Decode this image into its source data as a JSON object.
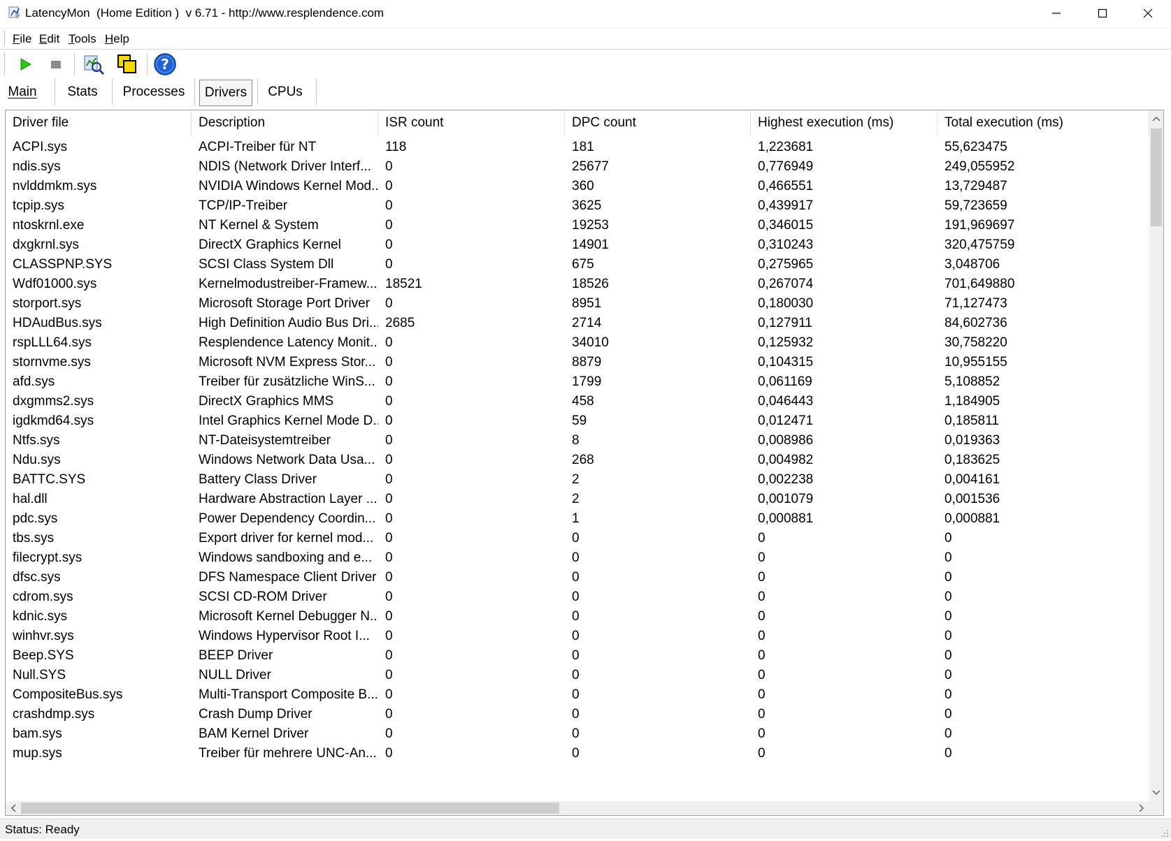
{
  "window": {
    "title": "LatencyMon  (Home Edition )  v 6.71 - http://www.resplendence.com"
  },
  "menu": [
    {
      "label": "File",
      "accel": "F",
      "rest": "ile"
    },
    {
      "label": "Edit",
      "accel": "E",
      "rest": "dit"
    },
    {
      "label": "Tools",
      "accel": "T",
      "rest": "ools"
    },
    {
      "label": "Help",
      "accel": "H",
      "rest": "elp"
    }
  ],
  "toolbar": {
    "icons": [
      "play-icon",
      "stop-icon",
      "inspect-icon",
      "copy-windows-icon",
      "help-icon"
    ],
    "colors": {
      "play": "#2ec41a",
      "stop": "#8c8c8c",
      "help": "#1d63d8"
    }
  },
  "tabs": [
    {
      "label": "Main",
      "active": false
    },
    {
      "label": "Stats",
      "active": false
    },
    {
      "label": "Processes",
      "active": false
    },
    {
      "label": "Drivers",
      "active": true
    },
    {
      "label": "CPUs",
      "active": false
    }
  ],
  "table": {
    "columns": [
      "Driver file",
      "Description",
      "ISR count",
      "DPC count",
      "Highest execution (ms)",
      "Total execution (ms)"
    ],
    "rows": [
      [
        "ACPI.sys",
        "ACPI-Treiber für NT",
        "118",
        "181",
        "1,223681",
        "55,623475"
      ],
      [
        "ndis.sys",
        "NDIS (Network Driver Interf...",
        "0",
        "25677",
        "0,776949",
        "249,055952"
      ],
      [
        "nvlddmkm.sys",
        "NVIDIA Windows Kernel Mod...",
        "0",
        "360",
        "0,466551",
        "13,729487"
      ],
      [
        "tcpip.sys",
        "TCP/IP-Treiber",
        "0",
        "3625",
        "0,439917",
        "59,723659"
      ],
      [
        "ntoskrnl.exe",
        "NT Kernel & System",
        "0",
        "19253",
        "0,346015",
        "191,969697"
      ],
      [
        "dxgkrnl.sys",
        "DirectX Graphics Kernel",
        "0",
        "14901",
        "0,310243",
        "320,475759"
      ],
      [
        "CLASSPNP.SYS",
        "SCSI Class System Dll",
        "0",
        "675",
        "0,275965",
        "3,048706"
      ],
      [
        "Wdf01000.sys",
        "Kernelmodustreiber-Framew...",
        "18521",
        "18526",
        "0,267074",
        "701,649880"
      ],
      [
        "storport.sys",
        "Microsoft Storage Port Driver",
        "0",
        "8951",
        "0,180030",
        "71,127473"
      ],
      [
        "HDAudBus.sys",
        "High Definition Audio Bus Dri...",
        "2685",
        "2714",
        "0,127911",
        "84,602736"
      ],
      [
        "rspLLL64.sys",
        "Resplendence Latency Monit...",
        "0",
        "34010",
        "0,125932",
        "30,758220"
      ],
      [
        "stornvme.sys",
        "Microsoft NVM Express Stor...",
        "0",
        "8879",
        "0,104315",
        "10,955155"
      ],
      [
        "afd.sys",
        "Treiber für zusätzliche WinS...",
        "0",
        "1799",
        "0,061169",
        "5,108852"
      ],
      [
        "dxgmms2.sys",
        "DirectX Graphics MMS",
        "0",
        "458",
        "0,046443",
        "1,184905"
      ],
      [
        "igdkmd64.sys",
        "Intel Graphics Kernel Mode D...",
        "0",
        "59",
        "0,012471",
        "0,185811"
      ],
      [
        "Ntfs.sys",
        "NT-Dateisystemtreiber",
        "0",
        "8",
        "0,008986",
        "0,019363"
      ],
      [
        "Ndu.sys",
        "Windows Network Data Usa...",
        "0",
        "268",
        "0,004982",
        "0,183625"
      ],
      [
        "BATTC.SYS",
        "Battery Class Driver",
        "0",
        "2",
        "0,002238",
        "0,004161"
      ],
      [
        "hal.dll",
        "Hardware Abstraction Layer ...",
        "0",
        "2",
        "0,001079",
        "0,001536"
      ],
      [
        "pdc.sys",
        "Power Dependency Coordin...",
        "0",
        "1",
        "0,000881",
        "0,000881"
      ],
      [
        "tbs.sys",
        "Export driver for kernel mod...",
        "0",
        "0",
        "0",
        "0"
      ],
      [
        "filecrypt.sys",
        "Windows sandboxing and e...",
        "0",
        "0",
        "0",
        "0"
      ],
      [
        "dfsc.sys",
        "DFS Namespace Client Driver",
        "0",
        "0",
        "0",
        "0"
      ],
      [
        "cdrom.sys",
        "SCSI CD-ROM Driver",
        "0",
        "0",
        "0",
        "0"
      ],
      [
        "kdnic.sys",
        "Microsoft Kernel Debugger N...",
        "0",
        "0",
        "0",
        "0"
      ],
      [
        "winhvr.sys",
        "Windows Hypervisor Root I...",
        "0",
        "0",
        "0",
        "0"
      ],
      [
        "Beep.SYS",
        "BEEP Driver",
        "0",
        "0",
        "0",
        "0"
      ],
      [
        "Null.SYS",
        "NULL Driver",
        "0",
        "0",
        "0",
        "0"
      ],
      [
        "CompositeBus.sys",
        "Multi-Transport Composite B...",
        "0",
        "0",
        "0",
        "0"
      ],
      [
        "crashdmp.sys",
        "Crash Dump Driver",
        "0",
        "0",
        "0",
        "0"
      ],
      [
        "bam.sys",
        "BAM Kernel Driver",
        "0",
        "0",
        "0",
        "0"
      ],
      [
        "mup.sys",
        "Treiber für mehrere UNC-An...",
        "0",
        "0",
        "0",
        "0"
      ]
    ]
  },
  "status": {
    "text": "Status: Ready"
  }
}
